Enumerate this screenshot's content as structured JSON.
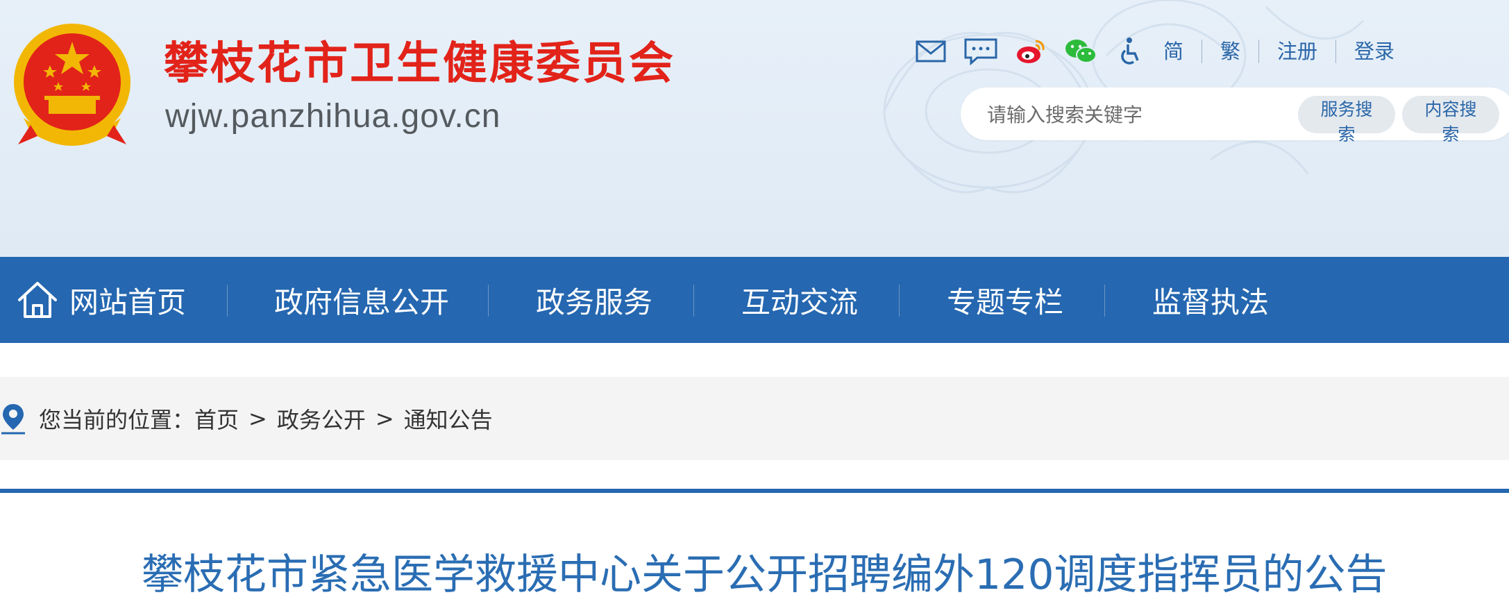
{
  "header": {
    "site_title": "攀枝花市卫生健康委员会",
    "site_domain": "wjw.panzhihua.gov.cn",
    "tool_icons": [
      "mail-icon",
      "message-icon",
      "weibo-icon",
      "wechat-icon",
      "accessibility-icon"
    ],
    "links": {
      "simplified": "简",
      "traditional": "繁",
      "register": "注册",
      "login": "登录"
    },
    "search": {
      "placeholder": "请输入搜索关键字",
      "service_button": "服务搜索",
      "content_button": "内容搜索"
    }
  },
  "nav": {
    "items": [
      {
        "label": "网站首页",
        "icon": "home-icon"
      },
      {
        "label": "政府信息公开"
      },
      {
        "label": "政务服务"
      },
      {
        "label": "互动交流"
      },
      {
        "label": "专题专栏"
      },
      {
        "label": "监督执法"
      }
    ]
  },
  "breadcrumb": {
    "prefix": "您当前的位置：",
    "items": [
      "首页",
      "政务公开",
      "通知公告"
    ],
    "separator": ">"
  },
  "article": {
    "title": "攀枝花市紧急医学救援中心关于公开招聘编外120调度指挥员的公告"
  },
  "colors": {
    "brand_red": "#e2231a",
    "nav_blue": "#2567b0",
    "link_blue": "#2a66a8",
    "title_blue": "#2a6db3"
  }
}
